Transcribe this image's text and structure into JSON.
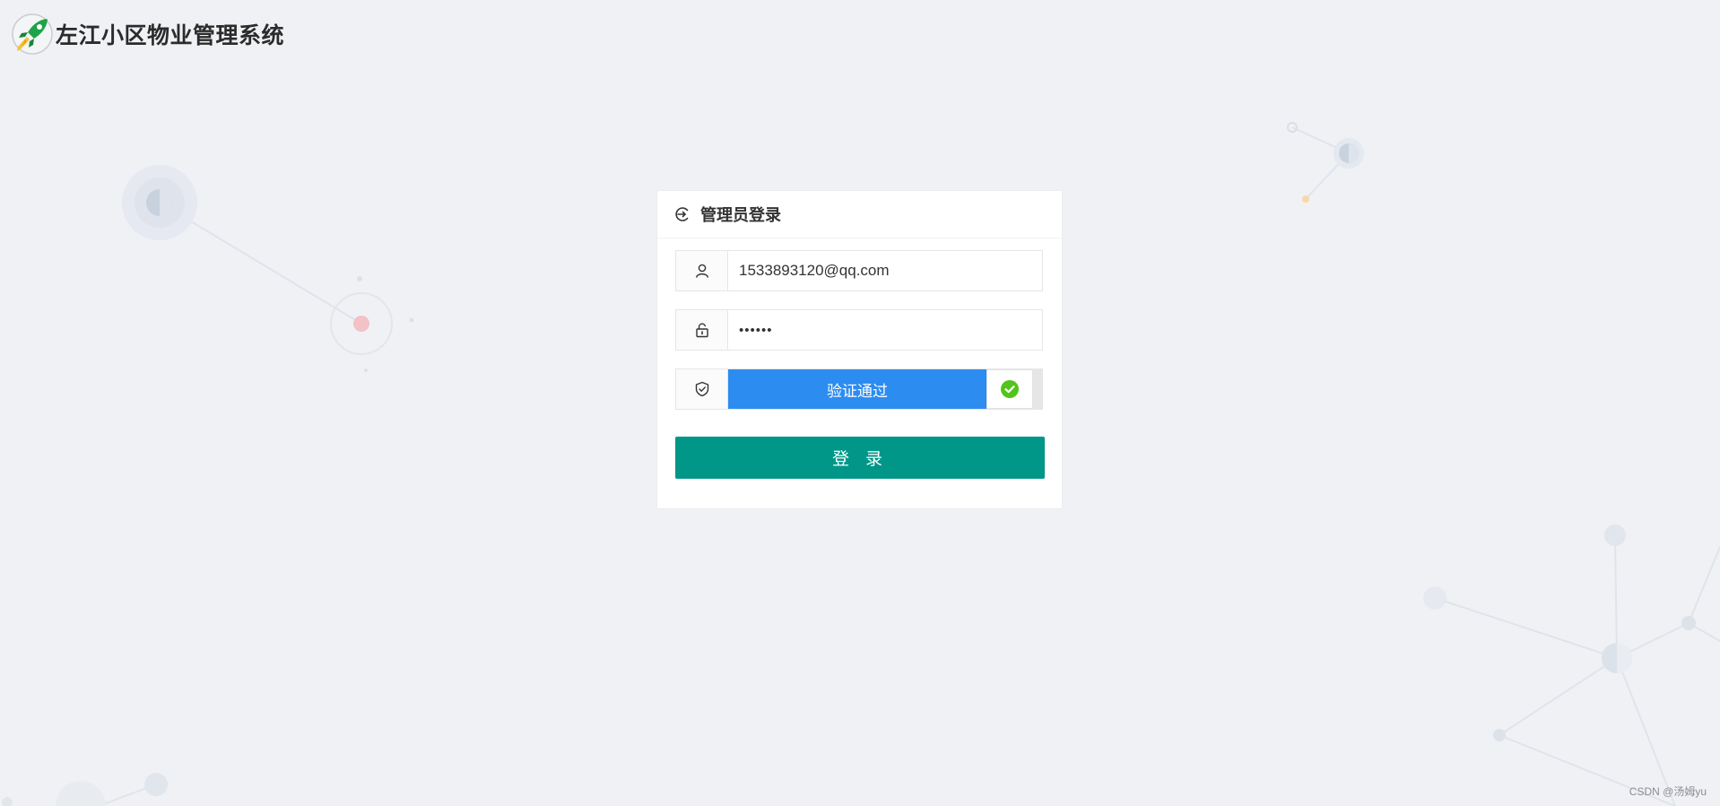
{
  "brand": {
    "title": "左江小区物业管理系统",
    "logo_icon": "rocket-icon"
  },
  "login": {
    "title": "管理员登录",
    "title_icon": "login-icon",
    "username": {
      "value": "1533893120@qq.com",
      "icon": "user-icon"
    },
    "password": {
      "value": "••••••",
      "icon": "lock-icon"
    },
    "captcha": {
      "status_text": "验证通过",
      "icon": "shield-check-icon",
      "handle_icon": "check-circle-icon"
    },
    "submit_label": "登 录"
  },
  "colors": {
    "background": "#f0f1f5",
    "slider_accent": "#2d8cf0",
    "button": "#009688",
    "success": "#52c41a"
  },
  "watermark": "CSDN @汤姆yu"
}
